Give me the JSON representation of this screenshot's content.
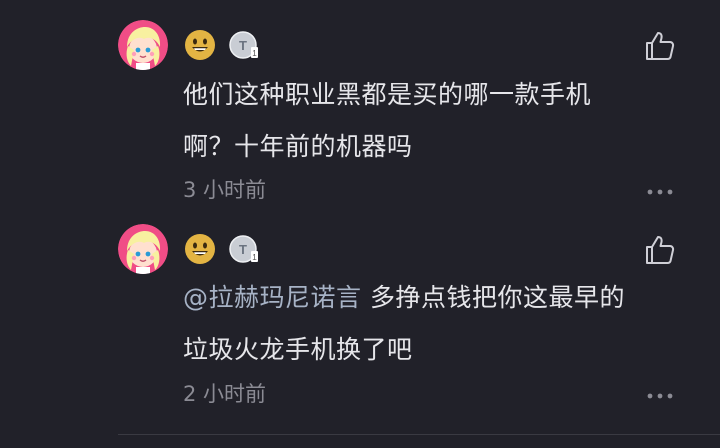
{
  "comments": [
    {
      "avatar_icon": "pink-hair-avatar",
      "badge_emoji_icon": "grinning-face-icon",
      "badge_level_icon": "level-t-badge-icon",
      "line1": "他们这种职业黑都是买的哪一款手机",
      "line2": "啊？十年前的机器吗",
      "time": "3 小时前"
    },
    {
      "avatar_icon": "pink-hair-avatar",
      "badge_emoji_icon": "grinning-face-icon",
      "badge_level_icon": "level-t-badge-icon",
      "mention": "@拉赫玛尼诺言",
      "line1_rest": "多挣点钱把你这最早的",
      "line2": "垃圾火龙手机换了吧",
      "time": "2 小时前"
    }
  ],
  "colors": {
    "background": "#212129",
    "text": "#e6e6ea",
    "mention": "#a7b3c6",
    "meta": "#8b8b94"
  }
}
